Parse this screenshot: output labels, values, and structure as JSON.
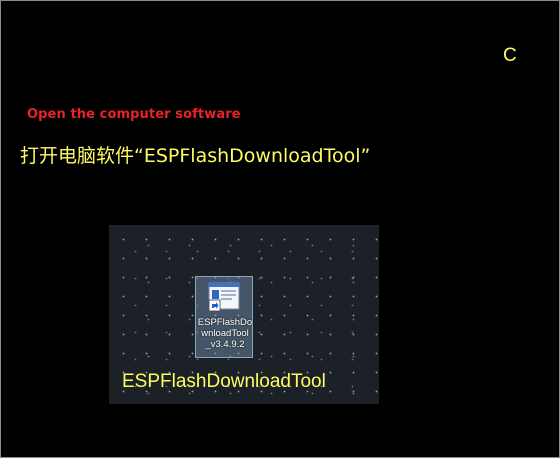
{
  "step_letter": "C",
  "caption_en": "Open the computer software",
  "caption_cn": "打开电脑软件“ESPFlashDownloadTool”",
  "desktop": {
    "shortcut": {
      "label": "ESPFlashDownloadTool_v3.4.9.2",
      "label_lines": "ESPFlashDo\nwnloadTool\n_v3.4.9.2",
      "icon": "program-shortcut-icon"
    },
    "caption": "ESPFlashDownloadTool"
  },
  "colors": {
    "background": "#000000",
    "caption_yellow": "#fffb63",
    "caption_red": "#e8222a",
    "desktop_bg": "#1c2127"
  }
}
